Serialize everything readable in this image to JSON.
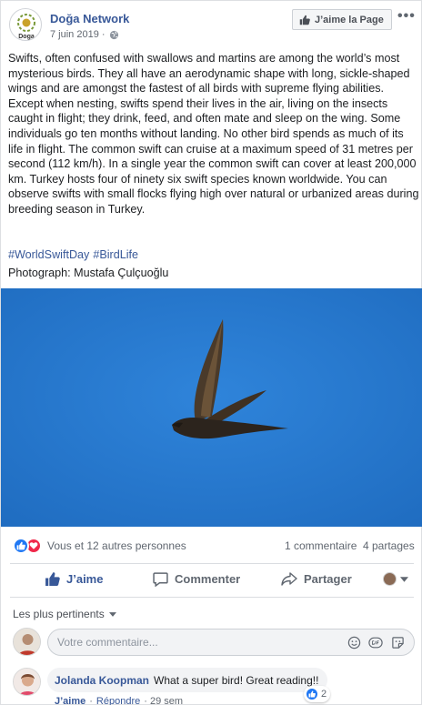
{
  "post": {
    "page_name": "Doğa Network",
    "avatar_text": "Doga",
    "date": "7 juin 2019 ·",
    "like_page_label": "J’aime la Page",
    "more_label": "•••",
    "text": "Swifts, often confused with swallows and martins are among the world’s most mysterious birds. They all have an aerodynamic shape with long, sickle-shaped wings and are amongst the fastest of all birds with supreme flying abilities. Except when nesting, swifts spend their lives in the air, living on the insects caught in flight; they drink, feed, and often mate and sleep on the wing. Some individuals go ten months without landing. No other bird spends as much of its life in flight. The common swift can cruise at a maximum speed of 31 metres per second (112 km/h). In a single year the common swift can cover at least 200,000 km. Turkey hosts four of ninety six swift species known worldwide. You can observe swifts with small flocks flying high over natural or urbanized areas during breeding season in Turkey.",
    "hashtags": [
      "#WorldSwiftDay",
      "#BirdLife"
    ],
    "photo_credit": "Photograph: Mustafa Çulçuoğlu",
    "photo_sky_color": "#2a7ad0"
  },
  "reactions": {
    "summary": "Vous et 12 autres personnes",
    "comments": "1 commentaire",
    "shares": "4 partages",
    "like_color": "#2078f4",
    "love_color": "#f0284a"
  },
  "actions": {
    "like": "J’aime",
    "comment": "Commenter",
    "share": "Partager"
  },
  "comments_section": {
    "sort_label": "Les plus pertinents",
    "composer_placeholder": "Votre commentaire...",
    "comment": {
      "author": "Jolanda Koopman",
      "text": "What a super bird! Great reading!!",
      "reaction_count": "2",
      "like_label": "J’aime",
      "separator": "·",
      "reply_label": "Répondre",
      "time": "· 29 sem"
    }
  },
  "colors": {
    "link_blue": "#385898",
    "secondary_text": "#606770"
  }
}
